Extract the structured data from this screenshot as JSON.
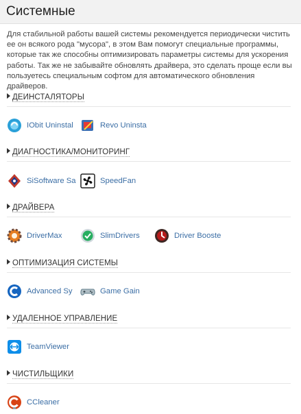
{
  "header": {
    "title": "Системные"
  },
  "intro": "Для стабильной работы вашей системы рекомендуется периодически чистить ее он всякого рода \"мусора\", в этом Вам помогут специальные программы, которые так же способны оптимизировать параметры системы для ускорения работы. Так же не забывайте обновлять драйвера, это сделать проще если вы пользуетесь специальным софтом для автоматического обновления драйверов.",
  "sections": [
    {
      "title": "ДЕИНСТАЛЯТОРЫ",
      "apps": [
        {
          "label": "IObit Uninstal",
          "icon": "iobit-uninstaller-icon",
          "color": "#2aa0d8"
        },
        {
          "label": "Revo Uninsta",
          "icon": "revo-uninstaller-icon",
          "color": "#3a6fb5"
        }
      ]
    },
    {
      "title": "ДИАГНОСТИКА/МОНИТОРИНГ",
      "apps": [
        {
          "label": "SiSoftware Sa",
          "icon": "sisoftware-sandra-icon",
          "color": "#c0392b"
        },
        {
          "label": "SpeedFan",
          "icon": "speedfan-icon",
          "color": "#111111"
        }
      ]
    },
    {
      "title": "ДРАЙВЕРА",
      "apps": [
        {
          "label": "DriverMax",
          "icon": "drivermax-icon",
          "color": "#e67e22"
        },
        {
          "label": "SlimDrivers",
          "icon": "slimdrivers-icon",
          "color": "#27ae60"
        },
        {
          "label": "Driver Booste",
          "icon": "driver-booster-icon",
          "color": "#b71c1c"
        }
      ]
    },
    {
      "title": "ОПТИМИЗАЦИЯ СИСТЕМЫ",
      "apps": [
        {
          "label": "Advanced Sy",
          "icon": "advanced-systemcare-icon",
          "color": "#1565c0"
        },
        {
          "label": "Game Gain",
          "icon": "game-gain-icon",
          "color": "#90a4ae"
        }
      ]
    },
    {
      "title": "УДАЛЕННОЕ УПРАВЛЕНИЕ",
      "apps": [
        {
          "label": "TeamViewer",
          "icon": "teamviewer-icon",
          "color": "#0e8ee9"
        }
      ]
    },
    {
      "title": "ЧИСТИЛЬЩИКИ",
      "apps": [
        {
          "label": "CCleaner",
          "icon": "ccleaner-icon",
          "color": "#d84315"
        }
      ]
    }
  ]
}
